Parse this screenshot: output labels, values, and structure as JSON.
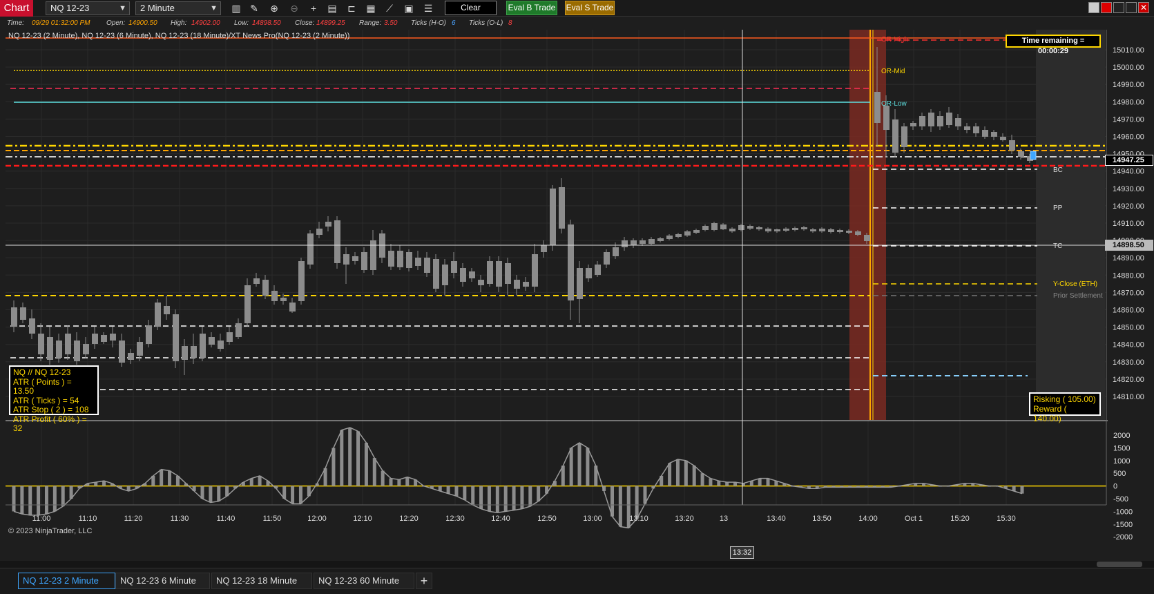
{
  "toolbar": {
    "chart_label": "Chart",
    "instrument": "NQ 12-23",
    "interval": "2 Minute",
    "clear_label": "Clear",
    "eval_b_label": "Eval B Trade",
    "eval_s_label": "Eval S Trade",
    "icons": [
      "bar-style-icon",
      "draw-icon",
      "zoom-in-icon",
      "zoom-out-icon",
      "crosshair-icon",
      "properties-icon",
      "templates-icon",
      "indicators-icon",
      "strategies-icon",
      "calculator-icon",
      "list-icon"
    ]
  },
  "info": {
    "time_label": "Time:",
    "time_value": "09/29 01:32:00 PM",
    "open_label": "Open:",
    "open_value": "14900.50",
    "high_label": "High:",
    "high_value": "14902.00",
    "low_label": "Low:",
    "low_value": "14898.50",
    "close_label": "Close:",
    "close_value": "14899.25",
    "range_label": "Range:",
    "range_value": "3.50",
    "ticks_ho_label": "Ticks (H-O)",
    "ticks_ho_value": "6",
    "ticks_ol_label": "Ticks (O-L)",
    "ticks_ol_value": "8"
  },
  "chart": {
    "series_title": "NQ 12-23 (2 Minute), NQ 12-23 (6 Minute), NQ 12-23 (18 Minute)/XT News Pro(NQ 12-23 (2 Minute))",
    "time_remaining": "Time remaining = 00:00:29",
    "copyright": "© 2023 NinjaTrader, LLC",
    "price_label_current": "14947.25",
    "price_label_cursor": "14898.50",
    "time_cursor": "13:32",
    "price_ticks": [
      "15010.00",
      "15000.00",
      "14990.00",
      "14980.00",
      "14970.00",
      "14960.00",
      "14950.00",
      "14940.00",
      "14930.00",
      "14920.00",
      "14910.00",
      "14900.00",
      "14890.00",
      "14880.00",
      "14870.00",
      "14860.00",
      "14850.00",
      "14840.00",
      "14830.00",
      "14820.00",
      "14810.00"
    ],
    "osc_ticks": [
      "2000",
      "1500",
      "1000",
      "500",
      "0",
      "-500",
      "-1000",
      "-1500",
      "-2000"
    ],
    "time_ticks": [
      "11:00",
      "11:10",
      "11:20",
      "11:30",
      "11:40",
      "11:50",
      "12:00",
      "12:10",
      "12:20",
      "12:30",
      "12:40",
      "12:50",
      "13:00",
      "13:10",
      "13:20",
      "13",
      "13:40",
      "13:50",
      "14:00",
      "Oct 1",
      "15:20",
      "15:30"
    ],
    "level_labels": {
      "or_high": "OR-High",
      "or_mid": "OR-Mid",
      "or_low": "OR-Low",
      "bc": "BC",
      "pp": "PP",
      "tc": "TC",
      "y_close": "Y-Close (ETH)",
      "prior_settlement": "Prior Settlement"
    },
    "atr": {
      "title": "NQ // NQ 12-23",
      "points": "ATR ( Points ) = 13.50",
      "ticks": "ATR ( Ticks ) = 54",
      "stop": "ATR Stop ( 2 ) = 108",
      "profit": "ATR Profit ( 60% ) = 32"
    },
    "risk": {
      "risking": "Risking ( 105.00)",
      "reward": "Reward  ( 140.00)"
    },
    "colors": {
      "up": "#8c8c8c",
      "down": "#8c8c8c",
      "session_band": "#7a2a22",
      "accent": "#ffd700",
      "last_bar": "#3ea6ff"
    }
  },
  "tabs": [
    {
      "label": "NQ 12-23 2 Minute",
      "active": true
    },
    {
      "label": "NQ 12-23 6 Minute",
      "active": false
    },
    {
      "label": "NQ 12-23 18 Minute",
      "active": false
    },
    {
      "label": "NQ 12-23 60 Minute",
      "active": false
    }
  ]
}
